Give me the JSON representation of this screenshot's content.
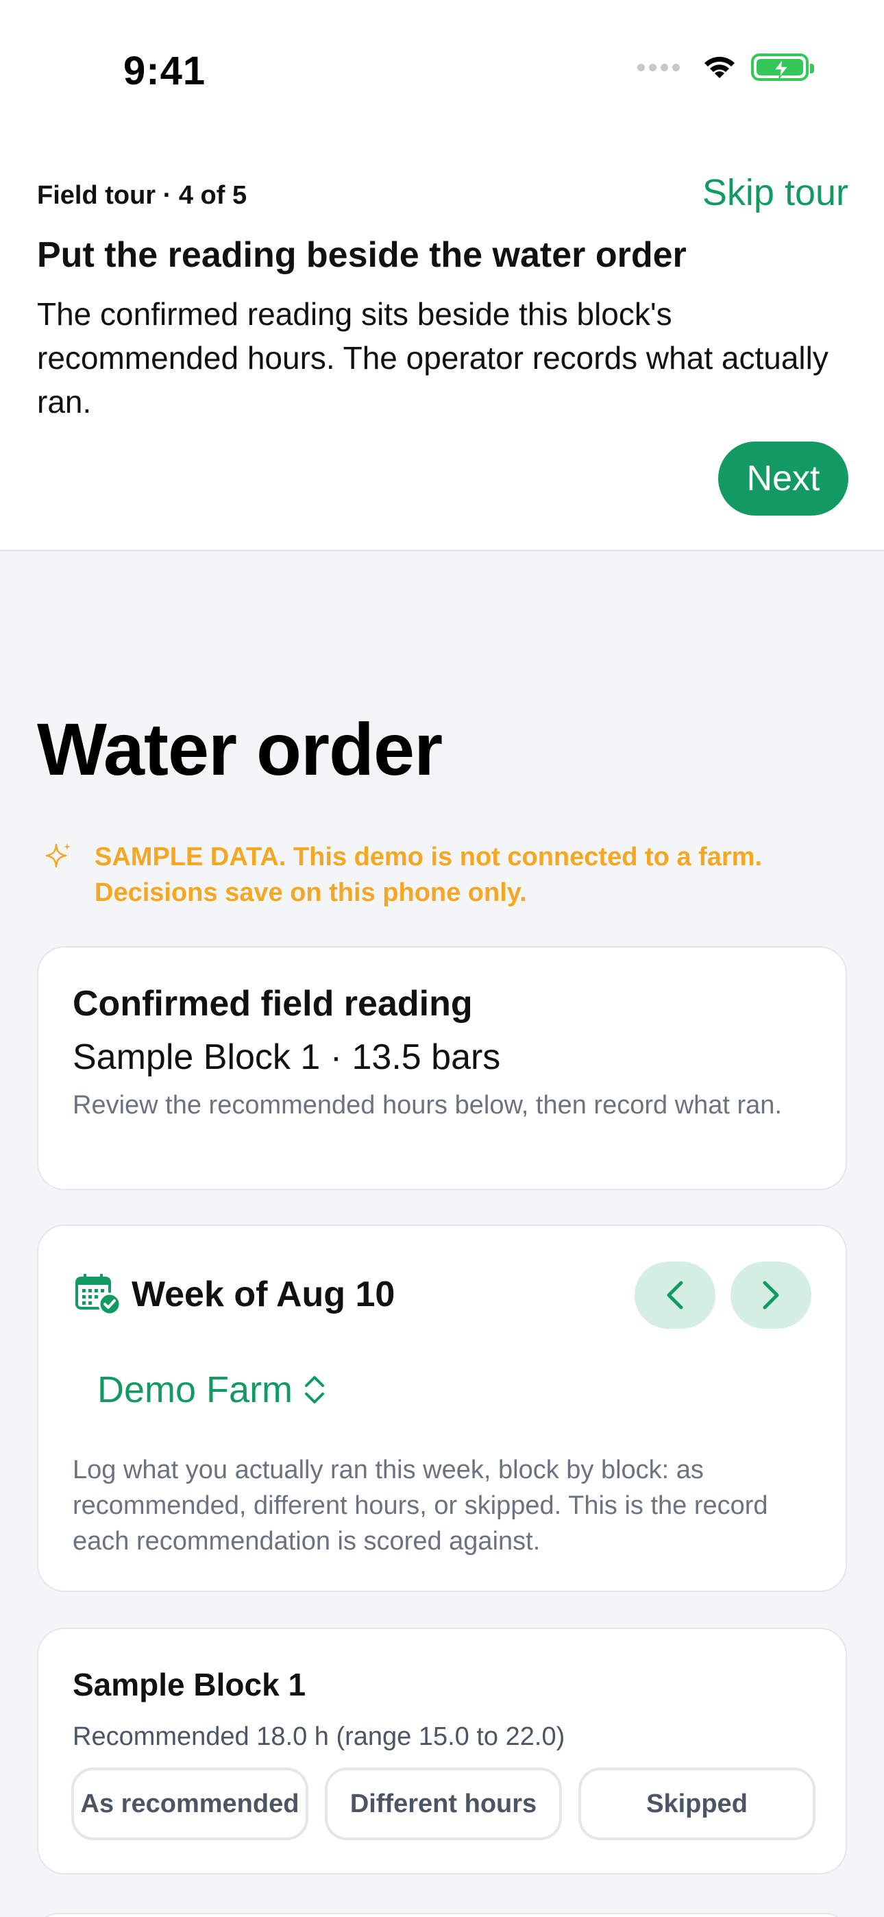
{
  "status_bar": {
    "time": "9:41"
  },
  "tour": {
    "step": "Field tour · 4 of 5",
    "skip_label": "Skip tour",
    "title": "Put the reading beside the water order",
    "body": "The confirmed reading sits beside this block's recommended hours. The operator records what actually ran.",
    "next_label": "Next"
  },
  "page": {
    "title": "Water order"
  },
  "sample_banner": {
    "icon": "sparkle-icon",
    "text": "SAMPLE DATA. This demo is not connected to a farm. Decisions save on this phone only."
  },
  "reading_card": {
    "title": "Confirmed field reading",
    "value": "Sample Block 1 · 13.5 bars",
    "note": "Review the recommended hours below, then record what ran."
  },
  "week_card": {
    "title": "Week of Aug 10",
    "farm": "Demo Farm",
    "note": "Log what you actually ran this week, block by block: as recommended, different hours, or skipped. This is the record each recommendation is scored against."
  },
  "block_card": {
    "title": "Sample Block 1",
    "recommendation": "Recommended 18.0 h (range 15.0 to 22.0)",
    "choices": [
      "As recommended",
      "Different hours",
      "Skipped"
    ]
  },
  "colors": {
    "accent": "#129a62",
    "accent_light": "#d4efe2",
    "warning": "#f5a623"
  }
}
